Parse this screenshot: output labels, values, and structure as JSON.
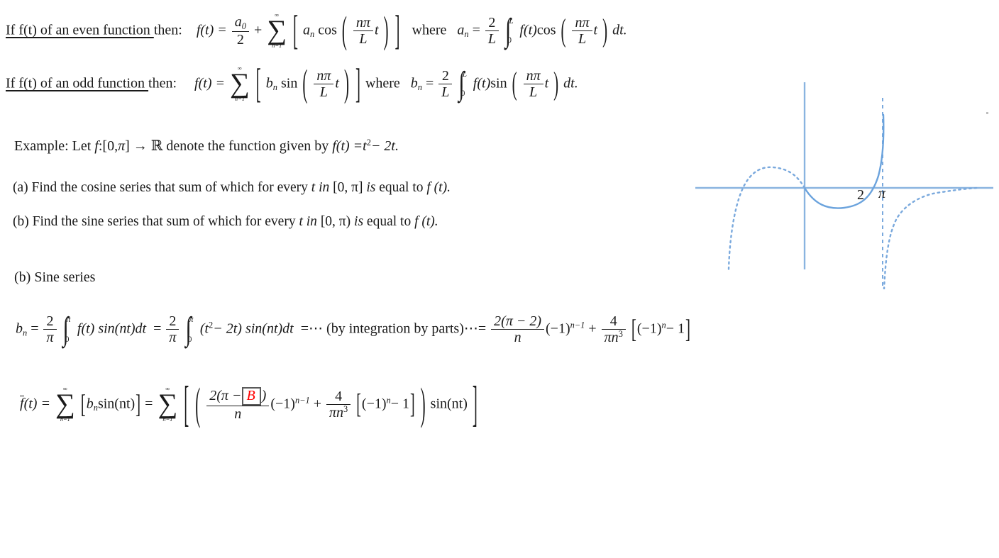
{
  "page": {
    "background": "#ffffff",
    "text_color": "#1a1a1a",
    "accent_color": "#8ab4e0",
    "answer_box_color": "#ff0000"
  },
  "rule_even": {
    "underlined_text": "If f(t) of an even function ",
    "then_label": "then:",
    "lhs": "f(t) =",
    "first_term_num": "a",
    "first_term_sub": "0",
    "first_term_den": "2",
    "plus": "+",
    "sum_top": "∞",
    "sum_symbol": "∑",
    "sum_bottom": "n=1",
    "coef": "a",
    "coef_sub": "n",
    "trig": "cos",
    "arg_num": "nπ",
    "arg_den": "L",
    "arg_var": "t",
    "where": "where",
    "coef_def_lhs": "a",
    "coef_def_sub": "n",
    "equals": "=",
    "front_num": "2",
    "front_den": "L",
    "int_top": "L",
    "int_bot": "0",
    "integrand": "f(t)",
    "dt": "dt."
  },
  "rule_odd": {
    "underlined_text": "If f(t) of an odd function ",
    "then_label": "then:",
    "lhs": "f(t) =",
    "sum_top": "∞",
    "sum_symbol": "∑",
    "sum_bottom": "n=1",
    "coef": "b",
    "coef_sub": "n",
    "trig": "sin",
    "arg_num": "nπ",
    "arg_den": "L",
    "arg_var": "t",
    "where": "where",
    "coef_def_lhs": "b",
    "coef_def_sub": "n",
    "equals": "=",
    "front_num": "2",
    "front_den": "L",
    "int_top": "L",
    "int_bot": "0",
    "integrand": "f(t)",
    "dt": "dt."
  },
  "example": {
    "lead": "Example: Let",
    "fn_name": "f",
    "colon": ":[0,",
    "pi": "π",
    "close_arrow": "] →",
    "reals": "ℝ",
    "middle": "denote the function given by",
    "def_lhs": "f(t) =",
    "def_var": "t",
    "def_pow": "2",
    "def_tail": "− 2t."
  },
  "part_a": {
    "marker": "(a)",
    "text1": "Find the cosine series that sum of which for every",
    "italic_t_in": "t in",
    "interval": "[0, π]",
    "italic_is": "is",
    "text2": "equal to",
    "fn": "f (t)."
  },
  "part_b": {
    "marker": "(b)",
    "text1": "Find the sine series that sum of which for every",
    "italic_t_in": "t in",
    "interval": "[0, π)",
    "italic_is": "is",
    "text2": "equal to",
    "fn": "f (t)."
  },
  "sine_heading": {
    "marker": "(b)",
    "title": "Sine series"
  },
  "bn_line": {
    "lhs": "b",
    "lhs_sub": "n",
    "eq1": "=",
    "front_num": "2",
    "front_den": "π",
    "int_top": "π",
    "int_bot": "0",
    "integrand1": "f(t) sin(nt)dt",
    "eq2": "=",
    "front2_num": "2",
    "front2_den": "π",
    "int2_top": "π",
    "int2_bot": "0",
    "integrand2_open": "(t",
    "integrand2_pow": "2",
    "integrand2_mid": "− 2t) sin(nt)dt",
    "eq3": "=",
    "dots_left": "⋯",
    "note": "(by integration by parts)",
    "dots_right": "⋯",
    "eq4": "=",
    "result_num": "2(π − 2)",
    "result_den": "n",
    "sign_factor": "(−1)",
    "sign_exp": "n−1",
    "plus": "+",
    "second_num": "4",
    "second_den_pi": "πn",
    "second_den_exp": "3",
    "bracket_inner": "(−1)",
    "bracket_exp": "n",
    "bracket_tail": "− 1"
  },
  "fbar_line": {
    "fbar": "f",
    "fbar_arg": "(t) =",
    "sum1_top": "∞",
    "sum_symbol": "∑",
    "sum1_bottom": "n=1",
    "inner1": "b",
    "inner1_sub": "n",
    "inner1_trig": "sin(nt)",
    "eq": "=",
    "sum2_top": "∞",
    "sum2_bottom": "n=1",
    "frac_num_open": "2(π −",
    "answer_box": "B",
    "frac_num_close": ")",
    "frac_den": "n",
    "sign_factor": "(−1)",
    "sign_exp": "n−1",
    "plus": "+",
    "second_num": "4",
    "second_den_pi": "πn",
    "second_den_exp": "3",
    "bracket_inner": "(−1)",
    "bracket_exp": "n",
    "bracket_tail": "− 1",
    "trailing_trig": "sin(nt)"
  },
  "graph": {
    "axis_color": "#8ab4e0",
    "curve_color": "#6ba3dd",
    "label_2": "2",
    "label_pi": "π",
    "description": "odd periodic extension of f(t)=t^2-2t sketch with solid branch on [0, pi] and dotted periodic continuations, dashed vertical asymptote at pi"
  }
}
